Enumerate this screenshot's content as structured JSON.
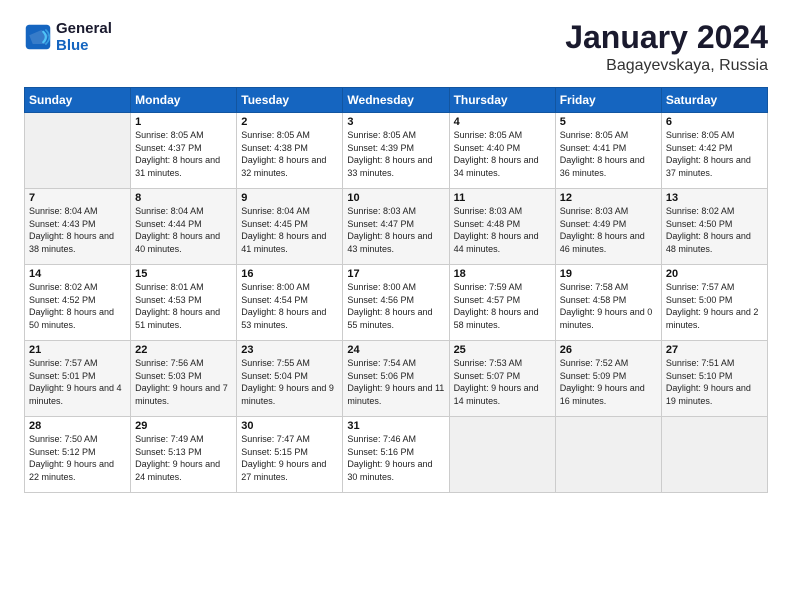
{
  "logo": {
    "line1": "General",
    "line2": "Blue"
  },
  "title": "January 2024",
  "subtitle": "Bagayevskaya, Russia",
  "weekdays": [
    "Sunday",
    "Monday",
    "Tuesday",
    "Wednesday",
    "Thursday",
    "Friday",
    "Saturday"
  ],
  "weeks": [
    [
      {
        "day": "",
        "empty": true
      },
      {
        "day": "1",
        "sunrise": "8:05 AM",
        "sunset": "4:37 PM",
        "daylight": "8 hours and 31 minutes."
      },
      {
        "day": "2",
        "sunrise": "8:05 AM",
        "sunset": "4:38 PM",
        "daylight": "8 hours and 32 minutes."
      },
      {
        "day": "3",
        "sunrise": "8:05 AM",
        "sunset": "4:39 PM",
        "daylight": "8 hours and 33 minutes."
      },
      {
        "day": "4",
        "sunrise": "8:05 AM",
        "sunset": "4:40 PM",
        "daylight": "8 hours and 34 minutes."
      },
      {
        "day": "5",
        "sunrise": "8:05 AM",
        "sunset": "4:41 PM",
        "daylight": "8 hours and 36 minutes."
      },
      {
        "day": "6",
        "sunrise": "8:05 AM",
        "sunset": "4:42 PM",
        "daylight": "8 hours and 37 minutes."
      }
    ],
    [
      {
        "day": "7",
        "sunrise": "8:04 AM",
        "sunset": "4:43 PM",
        "daylight": "8 hours and 38 minutes."
      },
      {
        "day": "8",
        "sunrise": "8:04 AM",
        "sunset": "4:44 PM",
        "daylight": "8 hours and 40 minutes."
      },
      {
        "day": "9",
        "sunrise": "8:04 AM",
        "sunset": "4:45 PM",
        "daylight": "8 hours and 41 minutes."
      },
      {
        "day": "10",
        "sunrise": "8:03 AM",
        "sunset": "4:47 PM",
        "daylight": "8 hours and 43 minutes."
      },
      {
        "day": "11",
        "sunrise": "8:03 AM",
        "sunset": "4:48 PM",
        "daylight": "8 hours and 44 minutes."
      },
      {
        "day": "12",
        "sunrise": "8:03 AM",
        "sunset": "4:49 PM",
        "daylight": "8 hours and 46 minutes."
      },
      {
        "day": "13",
        "sunrise": "8:02 AM",
        "sunset": "4:50 PM",
        "daylight": "8 hours and 48 minutes."
      }
    ],
    [
      {
        "day": "14",
        "sunrise": "8:02 AM",
        "sunset": "4:52 PM",
        "daylight": "8 hours and 50 minutes."
      },
      {
        "day": "15",
        "sunrise": "8:01 AM",
        "sunset": "4:53 PM",
        "daylight": "8 hours and 51 minutes."
      },
      {
        "day": "16",
        "sunrise": "8:00 AM",
        "sunset": "4:54 PM",
        "daylight": "8 hours and 53 minutes."
      },
      {
        "day": "17",
        "sunrise": "8:00 AM",
        "sunset": "4:56 PM",
        "daylight": "8 hours and 55 minutes."
      },
      {
        "day": "18",
        "sunrise": "7:59 AM",
        "sunset": "4:57 PM",
        "daylight": "8 hours and 58 minutes."
      },
      {
        "day": "19",
        "sunrise": "7:58 AM",
        "sunset": "4:58 PM",
        "daylight": "9 hours and 0 minutes."
      },
      {
        "day": "20",
        "sunrise": "7:57 AM",
        "sunset": "5:00 PM",
        "daylight": "9 hours and 2 minutes."
      }
    ],
    [
      {
        "day": "21",
        "sunrise": "7:57 AM",
        "sunset": "5:01 PM",
        "daylight": "9 hours and 4 minutes."
      },
      {
        "day": "22",
        "sunrise": "7:56 AM",
        "sunset": "5:03 PM",
        "daylight": "9 hours and 7 minutes."
      },
      {
        "day": "23",
        "sunrise": "7:55 AM",
        "sunset": "5:04 PM",
        "daylight": "9 hours and 9 minutes."
      },
      {
        "day": "24",
        "sunrise": "7:54 AM",
        "sunset": "5:06 PM",
        "daylight": "9 hours and 11 minutes."
      },
      {
        "day": "25",
        "sunrise": "7:53 AM",
        "sunset": "5:07 PM",
        "daylight": "9 hours and 14 minutes."
      },
      {
        "day": "26",
        "sunrise": "7:52 AM",
        "sunset": "5:09 PM",
        "daylight": "9 hours and 16 minutes."
      },
      {
        "day": "27",
        "sunrise": "7:51 AM",
        "sunset": "5:10 PM",
        "daylight": "9 hours and 19 minutes."
      }
    ],
    [
      {
        "day": "28",
        "sunrise": "7:50 AM",
        "sunset": "5:12 PM",
        "daylight": "9 hours and 22 minutes."
      },
      {
        "day": "29",
        "sunrise": "7:49 AM",
        "sunset": "5:13 PM",
        "daylight": "9 hours and 24 minutes."
      },
      {
        "day": "30",
        "sunrise": "7:47 AM",
        "sunset": "5:15 PM",
        "daylight": "9 hours and 27 minutes."
      },
      {
        "day": "31",
        "sunrise": "7:46 AM",
        "sunset": "5:16 PM",
        "daylight": "9 hours and 30 minutes."
      },
      {
        "day": "",
        "empty": true
      },
      {
        "day": "",
        "empty": true
      },
      {
        "day": "",
        "empty": true
      }
    ]
  ],
  "labels": {
    "sunrise": "Sunrise:",
    "sunset": "Sunset:",
    "daylight": "Daylight:"
  }
}
